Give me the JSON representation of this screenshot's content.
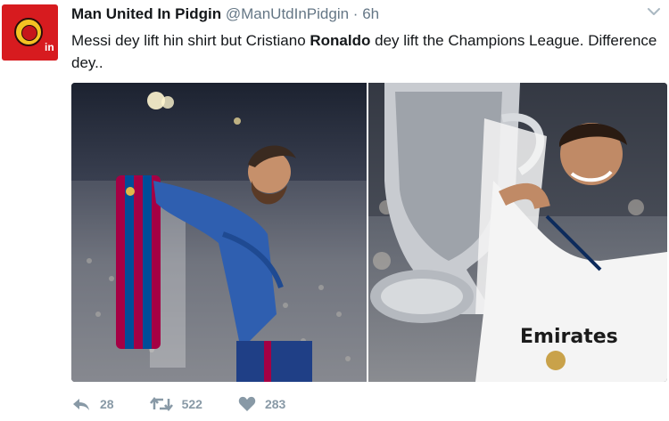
{
  "tweet": {
    "author_name": "Man United In Pidgin",
    "handle": "@ManUtdInPidgin",
    "separator": "·",
    "time": "6h",
    "text_part1": "Messi dey lift hin shirt but Cristiano ",
    "text_bold": "Ronaldo",
    "text_part2": " dey lift the Champions League. Difference dey..",
    "avatar_badge": "in"
  },
  "media": {
    "left_photo_text": "",
    "right_photo_text": "Emirates"
  },
  "actions": {
    "reply_count": "28",
    "retweet_count": "522",
    "like_count": "283"
  },
  "icons": {
    "reply": "reply-icon",
    "retweet": "retweet-icon",
    "like": "heart-icon",
    "menu": "chevron-down-icon"
  },
  "colors": {
    "barca_red": "#a50044",
    "barca_blue": "#004d98",
    "madrid_white": "#f4f4f4",
    "action_gray": "#8899a6",
    "avatar_red": "#d71b1f"
  }
}
